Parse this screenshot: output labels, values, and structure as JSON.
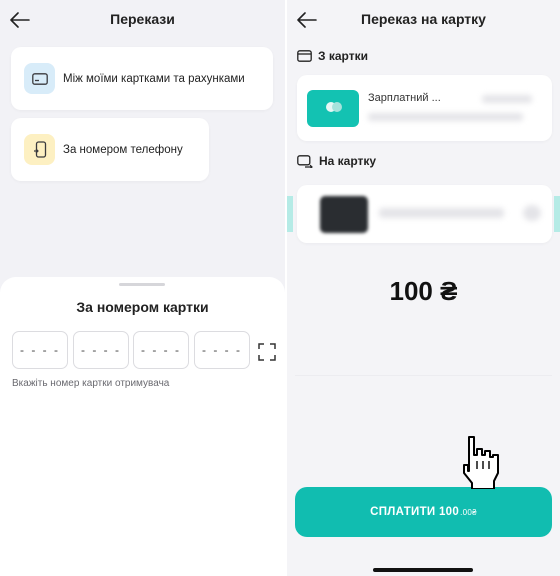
{
  "left": {
    "header": {
      "title": "Перекази"
    },
    "options": [
      {
        "label": "Між моїми картками та рахунками",
        "icon": "card-icon"
      },
      {
        "label": "За номером телефону",
        "icon": "phone-transfer-icon"
      }
    ],
    "sheet": {
      "title": "За номером картки",
      "digit_groups": [
        "- - - -",
        "- - - -",
        "- - - -",
        "- - - -"
      ],
      "hint": "Вкажіть номер картки отримувача"
    }
  },
  "right": {
    "header": {
      "title": "Переказ на картку"
    },
    "from_section": {
      "label": "З картки",
      "card_name": "Зарплатний ..."
    },
    "to_section": {
      "label": "На картку"
    },
    "amount": "100 ₴",
    "pay_button": {
      "label": "СПЛАТИТИ 100",
      "cents": ".00₴"
    }
  },
  "colors": {
    "accent": "#11bdb0",
    "mini_card": "#13c2b2"
  }
}
